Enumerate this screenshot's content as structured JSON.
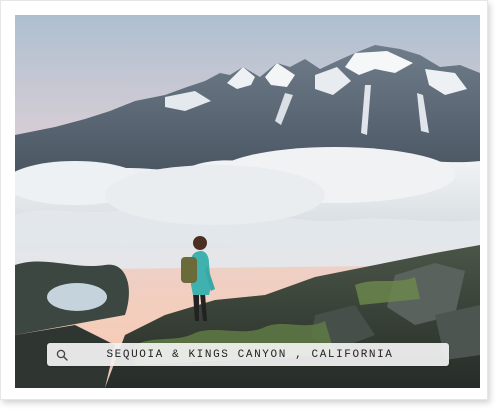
{
  "print": {
    "caption": "SEQUOIA & KINGS CANYON , CALIFORNIA",
    "caption_icon": "search-icon",
    "frame_color": "#ffffff"
  },
  "photo": {
    "colors": {
      "sky_top": "#b8c6d4",
      "sky_glow": "#f2c9b8",
      "mountain": "#5b6a78",
      "snow": "#f4f6f8",
      "cloud": "#e9edf0",
      "ridge": "#3f4a3f",
      "jacket": "#3fb2b0"
    }
  }
}
